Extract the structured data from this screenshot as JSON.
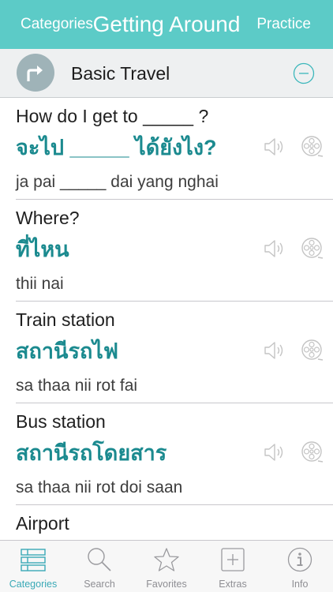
{
  "navbar": {
    "left_label": "Categories",
    "title": "Getting Around",
    "right_label": "Practice"
  },
  "section": {
    "title": "Basic Travel",
    "icon": "turn-right-arrow-icon",
    "collapse_icon": "minus-circle-icon"
  },
  "phrases": [
    {
      "english": "How do I get to _____ ?",
      "thai": "จะไป _____ ได้ยังไง?",
      "romanized": "ja pai _____ dai yang nghai"
    },
    {
      "english": "Where?",
      "thai": "ที่ไหน",
      "romanized": "thii nai"
    },
    {
      "english": "Train station",
      "thai": "สถานีรถไฟ",
      "romanized": "sa thaa nii rot fai"
    },
    {
      "english": "Bus station",
      "thai": "สถานีรถโดยสาร",
      "romanized": "sa thaa nii rot doi saan"
    },
    {
      "english": "Airport",
      "thai": "",
      "romanized": ""
    }
  ],
  "tabs": [
    {
      "label": "Categories",
      "icon": "list-icon",
      "active": true
    },
    {
      "label": "Search",
      "icon": "magnifier-icon",
      "active": false
    },
    {
      "label": "Favorites",
      "icon": "star-icon",
      "active": false
    },
    {
      "label": "Extras",
      "icon": "plus-square-icon",
      "active": false
    },
    {
      "label": "Info",
      "icon": "info-icon",
      "active": false
    }
  ],
  "colors": {
    "navbar": "#5ccbc7",
    "thai_text": "#1b8a8f",
    "active_tab": "#3aa9b6",
    "inactive_tab": "#8e8e93"
  }
}
